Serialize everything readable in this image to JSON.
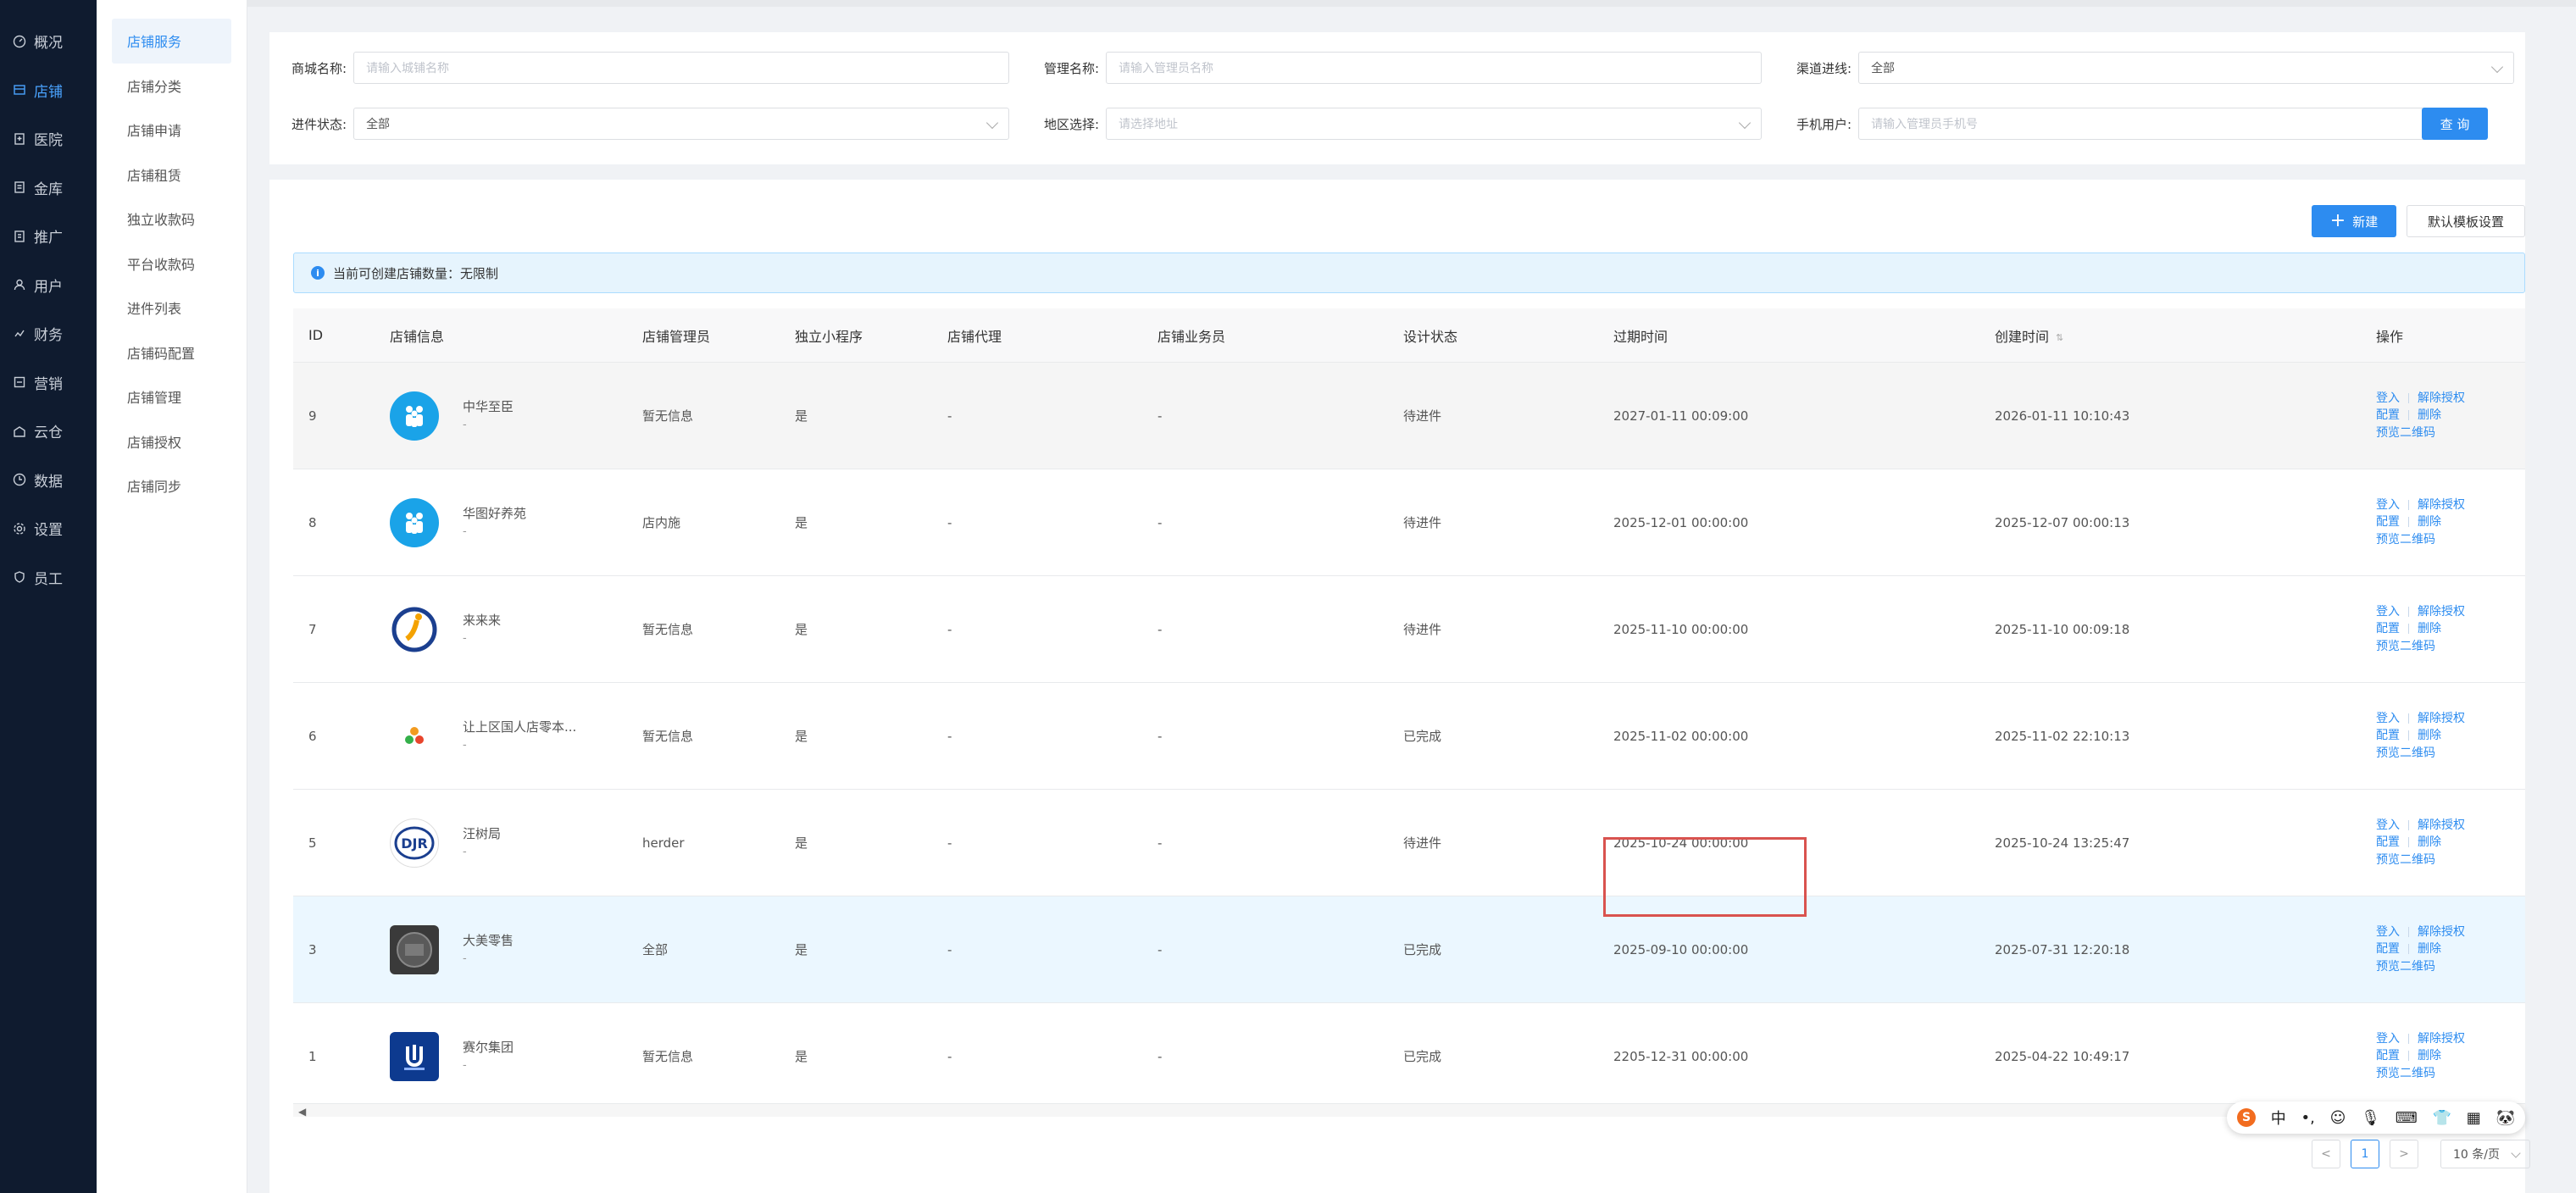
{
  "nav": {
    "items": [
      {
        "label": "概况",
        "icon": "dashboard-icon"
      },
      {
        "label": "店铺",
        "icon": "store-icon"
      },
      {
        "label": "医院",
        "icon": "hospital-icon"
      },
      {
        "label": "金库",
        "icon": "vault-icon"
      },
      {
        "label": "推广",
        "icon": "promotion-icon"
      },
      {
        "label": "用户",
        "icon": "user-icon"
      },
      {
        "label": "财务",
        "icon": "finance-icon"
      },
      {
        "label": "营销",
        "icon": "marketing-icon"
      },
      {
        "label": "云仓",
        "icon": "warehouse-icon"
      },
      {
        "label": "数据",
        "icon": "data-icon"
      },
      {
        "label": "设置",
        "icon": "settings-icon"
      },
      {
        "label": "员工",
        "icon": "staff-icon"
      }
    ],
    "active_index": 1
  },
  "submenu": {
    "items": [
      "店铺服务",
      "店铺分类",
      "店铺申请",
      "店铺租赁",
      "独立收款码",
      "平台收款码",
      "进件列表",
      "店铺码配置",
      "店铺管理",
      "店铺授权",
      "店铺同步"
    ],
    "active_index": 0
  },
  "filters": {
    "store_name_label": "商城名称:",
    "store_name_placeholder": "请输入城铺名称",
    "manager_label": "管理名称:",
    "manager_placeholder": "请输入管理员名称",
    "channel_label": "渠道进线:",
    "channel_value": "全部",
    "status_label": "进件状态:",
    "status_value": "全部",
    "region_label": "地区选择:",
    "region_placeholder": "请选择地址",
    "phone_label": "手机用户:",
    "phone_placeholder": "请输入管理员手机号",
    "query_label": "查 询"
  },
  "actions": {
    "new_label": "新建",
    "default_label": "默认模板设置"
  },
  "notice": {
    "text": "当前可创建店铺数量：无限制"
  },
  "table": {
    "headers": {
      "id": "ID",
      "store": "店铺信息",
      "manager": "店铺管理员",
      "mini": "独立小程序",
      "agent": "店铺代理",
      "sales": "店铺业务员",
      "design": "设计状态",
      "expire": "过期时间",
      "created": "创建时间",
      "ops": "操作"
    },
    "rows": [
      {
        "id": "9",
        "name": "中华至臣",
        "sub": "-",
        "manager": "暂无信息",
        "mini": "是",
        "agent": "-",
        "sales": "-",
        "design": "待进件",
        "expire": "2027-01-11 00:09:00",
        "created": "2026-01-11 10:10:43",
        "op1": "登入",
        "op2": "解除授权",
        "op3": "配置",
        "op4": "删除",
        "op5": "预览二维码",
        "logo": "people"
      },
      {
        "id": "8",
        "name": "华图好养苑",
        "sub": "-",
        "manager": "店内施",
        "mini": "是",
        "agent": "-",
        "sales": "-",
        "design": "待进件",
        "expire": "2025-12-01 00:00:00",
        "created": "2025-12-07 00:00:13",
        "op1": "登入",
        "op2": "解除授权",
        "op3": "配置",
        "op4": "删除",
        "op5": "预览二维码",
        "logo": "people"
      },
      {
        "id": "7",
        "name": "来来来",
        "sub": "-",
        "manager": "暂无信息",
        "mini": "是",
        "agent": "-",
        "sales": "-",
        "design": "待进件",
        "expire": "2025-11-10 00:00:00",
        "created": "2025-11-10 00:09:18",
        "op1": "登入",
        "op2": "解除授权",
        "op3": "配置",
        "op4": "删除",
        "op5": "预览二维码",
        "logo": "runner"
      },
      {
        "id": "6",
        "name": "让上区国人店零本...",
        "sub": "-",
        "manager": "暂无信息",
        "mini": "是",
        "agent": "-",
        "sales": "-",
        "design": "已完成",
        "expire": "2025-11-02 00:00:00",
        "created": "2025-11-02 22:10:13",
        "op1": "登入",
        "op2": "解除授权",
        "op3": "配置",
        "op4": "删除",
        "op5": "预览二维码",
        "logo": "dots"
      },
      {
        "id": "5",
        "name": "汪树局",
        "sub": "-",
        "manager": "herder",
        "mini": "是",
        "agent": "-",
        "sales": "-",
        "design": "待进件",
        "expire": "2025-10-24 00:00:00",
        "created": "2025-10-24 13:25:47",
        "op1": "登入",
        "op2": "解除授权",
        "op3": "配置",
        "op4": "删除",
        "op5": "预览二维码",
        "logo": "badge"
      },
      {
        "id": "3",
        "name": "大美零售",
        "sub": "-",
        "manager": "全部",
        "mini": "是",
        "agent": "-",
        "sales": "-",
        "design": "已完成",
        "expire": "2025-09-10 00:00:00",
        "created": "2025-07-31 12:20:18",
        "op1": "登入",
        "op2": "解除授权",
        "op3": "配置",
        "op4": "删除",
        "op5": "预览二维码",
        "logo": "dark"
      },
      {
        "id": "1",
        "name": "赛尔集团",
        "sub": "-",
        "manager": "暂无信息",
        "mini": "是",
        "agent": "-",
        "sales": "-",
        "design": "已完成",
        "expire": "2205-12-31 00:00:00",
        "created": "2025-04-22 10:49:17",
        "op1": "登入",
        "op2": "解除授权",
        "op3": "配置",
        "op4": "删除",
        "op5": "预览二维码",
        "logo": "blue"
      }
    ]
  },
  "pagination": {
    "current": "1",
    "prev": "<",
    "next": ">",
    "page_size": "10 条/页"
  },
  "ime": {
    "logo": "S",
    "mode": "中",
    "items": [
      "•,",
      "☺",
      "🎙",
      "⌨",
      "👕",
      "▦",
      "🐼"
    ]
  },
  "colors": {
    "nav_bg": "#0f1b2f",
    "accent": "#2d8cf0",
    "highlight_row": "#ebf7ff",
    "red_box": "#d9534f"
  }
}
